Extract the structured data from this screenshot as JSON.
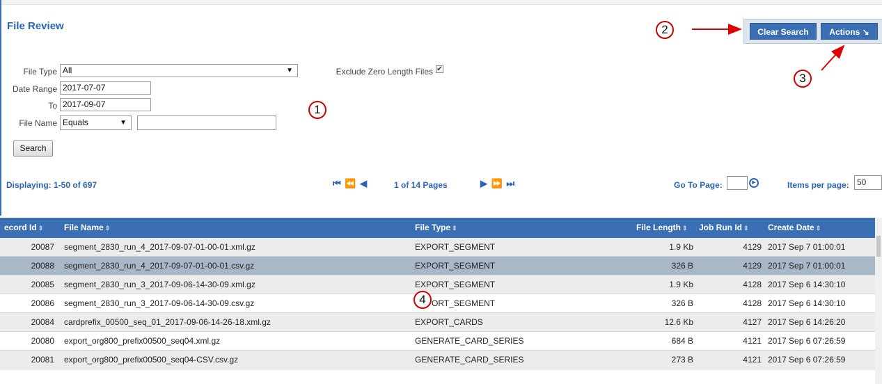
{
  "page": {
    "title": "File Review"
  },
  "toolbar": {
    "clear_search": "Clear Search",
    "actions": "Actions ↘"
  },
  "filters": {
    "file_type_label": "File Type",
    "file_type_value": "All",
    "exclude_zero_label": "Exclude Zero Length Files",
    "exclude_zero_checked": "✔",
    "date_range_label": "Date Range",
    "date_from": "2017-07-07",
    "to_label": "To",
    "date_to": "2017-09-07",
    "file_name_label": "File Name",
    "file_name_operator": "Equals",
    "file_name_value": "",
    "search_button": "Search",
    "dropdown_arrow": "▼"
  },
  "callouts": [
    "1",
    "2",
    "3",
    "4"
  ],
  "pager": {
    "displaying": "Displaying: 1-50 of 697",
    "first_prev": "⏮ ⏪ ◀",
    "page_info": "1 of 14 Pages",
    "next_last": "▶ ⏩ ⏭",
    "go_to_label": "Go To Page:",
    "go_icon": "▶",
    "items_per_page_label": "Items per page:",
    "items_per_page_value": "50"
  },
  "grid": {
    "headers": [
      "ecord Id",
      "File Name",
      "File Type",
      "File Length",
      "Job Run Id",
      "Create Date"
    ],
    "sort_icon": "⇕",
    "rows": [
      {
        "id": "20087",
        "name": "segment_2830_run_4_2017-09-07-01-00-01.xml.gz",
        "type": "EXPORT_SEGMENT",
        "length": "1.9 Kb",
        "job": "4129",
        "date": "2017 Sep 7 01:00:01"
      },
      {
        "id": "20088",
        "name": "segment_2830_run_4_2017-09-07-01-00-01.csv.gz",
        "type": "EXPORT_SEGMENT",
        "length": "326 B",
        "job": "4129",
        "date": "2017 Sep 7 01:00:01"
      },
      {
        "id": "20085",
        "name": "segment_2830_run_3_2017-09-06-14-30-09.xml.gz",
        "type": "EXPORT_SEGMENT",
        "length": "1.9 Kb",
        "job": "4128",
        "date": "2017 Sep 6 14:30:10"
      },
      {
        "id": "20086",
        "name": "segment_2830_run_3_2017-09-06-14-30-09.csv.gz",
        "type": "EXPORT_SEGMENT",
        "length": "326 B",
        "job": "4128",
        "date": "2017 Sep 6 14:30:10"
      },
      {
        "id": "20084",
        "name": "cardprefix_00500_seq_01_2017-09-06-14-26-18.xml.gz",
        "type": "EXPORT_CARDS",
        "length": "12.6 Kb",
        "job": "4127",
        "date": "2017 Sep 6 14:26:20"
      },
      {
        "id": "20080",
        "name": "export_org800_prefix00500_seq04.xml.gz",
        "type": "GENERATE_CARD_SERIES",
        "length": "684 B",
        "job": "4121",
        "date": "2017 Sep 6 07:26:59"
      },
      {
        "id": "20081",
        "name": "export_org800_prefix00500_seq04-CSV.csv.gz",
        "type": "GENERATE_CARD_SERIES",
        "length": "273 B",
        "job": "4121",
        "date": "2017 Sep 6 07:26:59"
      }
    ]
  }
}
